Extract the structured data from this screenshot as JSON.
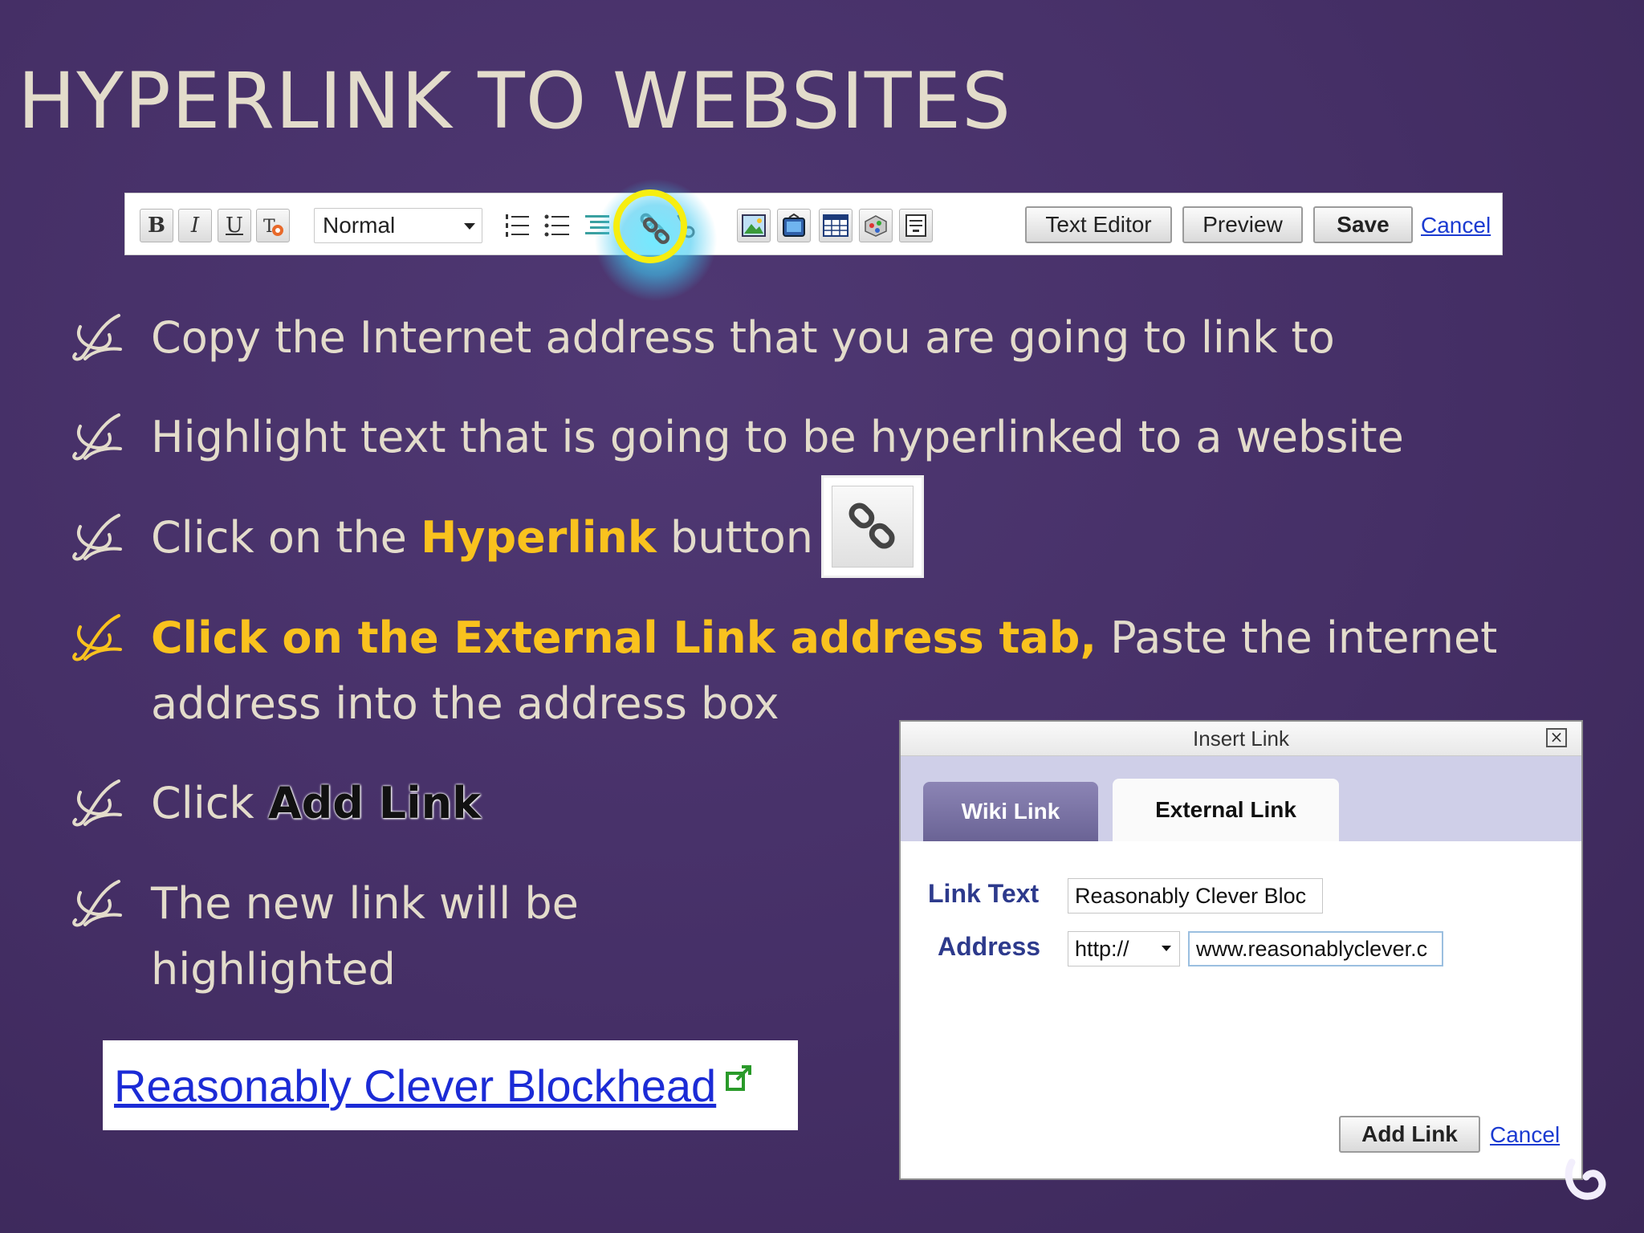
{
  "slide": {
    "title": "HYPERLINK TO WEBSITES"
  },
  "toolbar": {
    "bold_label": "B",
    "italic_label": "I",
    "underline_label": "U",
    "format_select_value": "Normal",
    "text_editor_label": "Text Editor",
    "preview_label": "Preview",
    "save_label": "Save",
    "cancel_label": "Cancel",
    "highlight_color": "#f6ee10"
  },
  "bullets": [
    {
      "text": "Copy the Internet address that you are going to link to"
    },
    {
      "text": "Highlight text that is going to be hyperlinked to a website"
    },
    {
      "prefix": "Click on the ",
      "highlight": "Hyperlink",
      "suffix": " button"
    },
    {
      "highlight": "Click on the External Link address tab,",
      "suffix": " Paste the internet",
      "line2": "address into the address box"
    },
    {
      "prefix": "Click ",
      "emphasis": "Add Link"
    },
    {
      "line1": "The new link will be",
      "line2": "highlighted"
    }
  ],
  "colors": {
    "accent": "#f9c21e",
    "text": "#e3dccb",
    "background": "#452f66"
  },
  "link_preview": {
    "text": "Reasonably Clever Blockhead",
    "icon": "external-link-icon"
  },
  "dialog": {
    "title": "Insert Link",
    "tabs": [
      {
        "label": "Wiki Link",
        "active": false
      },
      {
        "label": "External Link",
        "active": true
      }
    ],
    "link_text_label": "Link Text",
    "link_text_value": "Reasonably Clever Bloc",
    "address_label": "Address",
    "protocol_value": "http://",
    "address_value": "www.reasonablyclever.c",
    "add_link_label": "Add Link",
    "cancel_label": "Cancel"
  }
}
